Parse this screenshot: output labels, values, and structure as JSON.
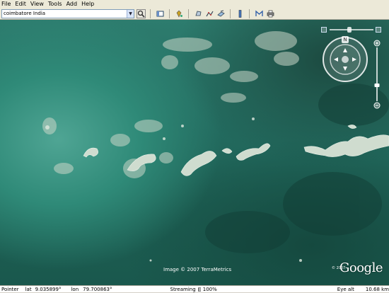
{
  "menubar": {
    "items": [
      {
        "label": "File"
      },
      {
        "label": "Edit"
      },
      {
        "label": "View"
      },
      {
        "label": "Tools"
      },
      {
        "label": "Add"
      },
      {
        "label": "Help"
      }
    ]
  },
  "toolbar": {
    "search_value": "coimbatore India",
    "icons": {
      "search": "search-icon",
      "sidebar": "sidebar-toggle-icon",
      "placemark": "add-placemark-icon",
      "polygon": "add-polygon-icon",
      "path": "add-path-icon",
      "overlay": "add-overlay-icon",
      "ruler": "ruler-icon",
      "email": "email-icon",
      "print": "print-icon"
    }
  },
  "viewport": {
    "copyright": "Image © 2007 TerraMetrics",
    "logo_small": "© 2007",
    "logo": "Google"
  },
  "navigation": {
    "north_label": "N"
  },
  "statusbar": {
    "pointer_label": "Pointer",
    "lat_label": "lat",
    "lat_value": "9.035899°",
    "lon_label": "lon",
    "lon_value": "79.700863°",
    "streaming_label": "Streaming",
    "streaming_percent": "100%",
    "streaming_fraction": 1.0,
    "eye_alt_label": "Eye alt",
    "eye_alt_value": "10.68 km"
  },
  "colors": {
    "sea_light": "#4fa594",
    "sea_dark": "#1a584d",
    "land": "#b7c9b9"
  }
}
